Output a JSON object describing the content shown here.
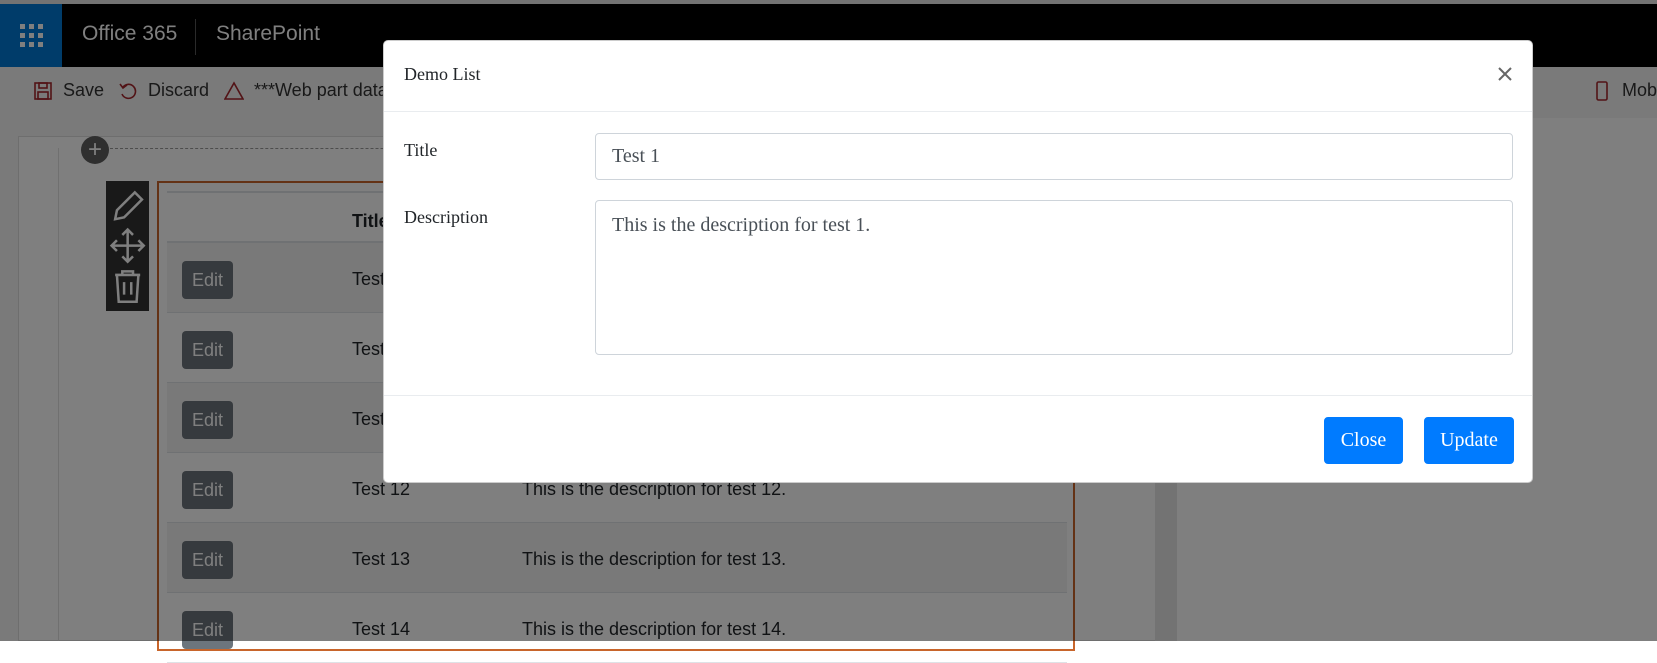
{
  "suite": {
    "brand": "Office 365",
    "app": "SharePoint"
  },
  "command_bar": {
    "save_label": "Save",
    "discard_label": "Discard",
    "warning_label": "***Web part data",
    "mobile_label": "Mob"
  },
  "webpart": {
    "header_title": "Title",
    "rows": [
      {
        "edit": "Edit",
        "title": "Test",
        "description": ""
      },
      {
        "edit": "Edit",
        "title": "Test",
        "description": ""
      },
      {
        "edit": "Edit",
        "title": "Test",
        "description": ""
      },
      {
        "edit": "Edit",
        "title": "Test 12",
        "description": "This is the description for test 12."
      },
      {
        "edit": "Edit",
        "title": "Test 13",
        "description": "This is the description for test 13."
      },
      {
        "edit": "Edit",
        "title": "Test 14",
        "description": "This is the description for test 14."
      }
    ]
  },
  "modal": {
    "title": "Demo List",
    "title_label": "Title",
    "title_value": "Test 1",
    "description_label": "Description",
    "description_value": "This is the description for test 1.",
    "close_label": "Close",
    "update_label": "Update"
  },
  "colors": {
    "suite_bar": "#000000",
    "waffle": "#0078d4",
    "primary_button": "#007bff",
    "edit_button": "#6c757d",
    "webpart_outline": "#c8652b"
  }
}
